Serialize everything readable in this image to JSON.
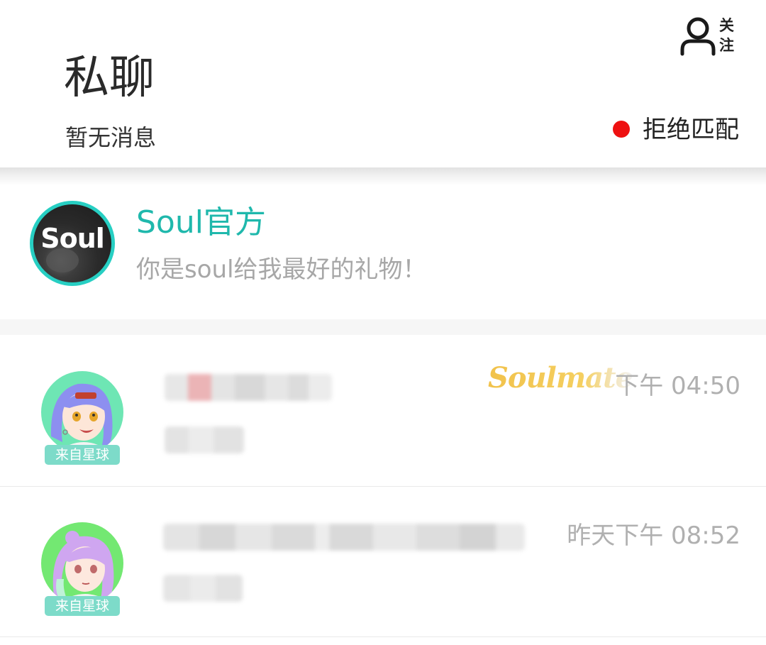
{
  "header": {
    "title": "私聊",
    "subtitle": "暂无消息",
    "follow_label": "关注",
    "reject_label": "拒绝匹配",
    "reject_dot_color": "#ee1111"
  },
  "official": {
    "avatar_text": "Soul",
    "name": "Soul官方",
    "message": "你是soul给我最好的礼物！",
    "accent_color": "#1fb8ac"
  },
  "chats": [
    {
      "badge": "来自星球",
      "tag": "Soulmate",
      "time": "下午 04:50",
      "avatar_icon": "anime-avatar-blue-hair-icon"
    },
    {
      "badge": "来自星球",
      "time": "昨天下午 08:52",
      "avatar_icon": "anime-avatar-purple-hair-icon"
    }
  ]
}
